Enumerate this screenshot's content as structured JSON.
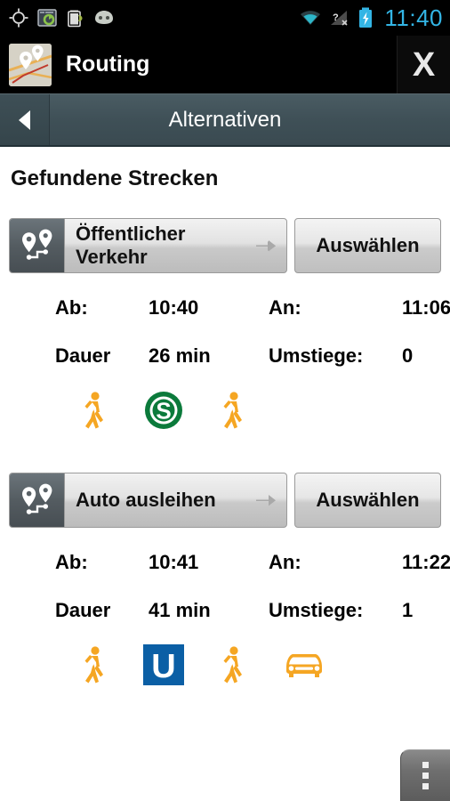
{
  "statusbar": {
    "icons": [
      "gps-crosshair-icon",
      "app-sync-icon",
      "battery-leaf-icon",
      "cyanogenmod-icon"
    ],
    "right_icons": [
      "wifi-icon",
      "signal-unknown-icon",
      "battery-charging-icon"
    ],
    "clock": "11:40",
    "clock_color": "#33b5e5"
  },
  "appbar": {
    "app_icon": "routing-map-icon",
    "title": "Routing",
    "close_label": "X"
  },
  "navbar": {
    "back_icon": "back-triangle-icon",
    "title": "Alternativen"
  },
  "main": {
    "section_title": "Gefundene Strecken",
    "labels": {
      "depart": "Ab:",
      "arrive": "An:",
      "duration": "Dauer",
      "transfers": "Umstiege:"
    },
    "select_label": "Auswählen",
    "routes": [
      {
        "name": "Öffentlicher Verkehr",
        "depart": "10:40",
        "arrive": "11:06",
        "duration": "26 min",
        "transfers": "0",
        "modes": [
          "walk-icon",
          "sbahn-icon",
          "walk-icon"
        ]
      },
      {
        "name": "Auto ausleihen",
        "depart": "10:41",
        "arrive": "11:22",
        "duration": "41 min",
        "transfers": "1",
        "modes": [
          "walk-icon",
          "ubahn-icon",
          "walk-icon",
          "car-icon"
        ]
      }
    ]
  },
  "overflow": {
    "label": "menu"
  },
  "colors": {
    "accent_blue": "#33b5e5",
    "walk_orange": "#f5a623",
    "sbahn_green": "#0b7a3b",
    "ubahn_blue": "#0b5fa5",
    "navbar": "#3f5057"
  }
}
